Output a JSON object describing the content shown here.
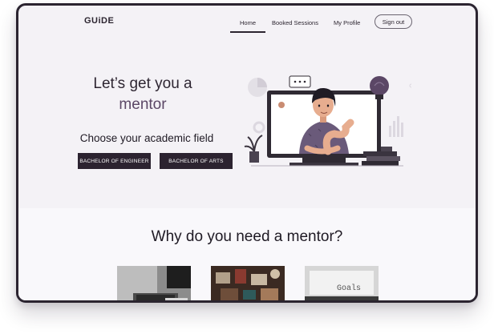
{
  "nav": {
    "logo": "GUiDE",
    "home": "Home",
    "booked": "Booked Sessions",
    "profile": "My Profile",
    "signout": "Sign out"
  },
  "hero": {
    "title_line1": "Let’s get you a",
    "title_line2": "mentor",
    "subtitle": "Choose your academic field",
    "btn_engineer": "BACHELOR OF ENGINEER",
    "btn_arts": "BACHELOR OF ARTS"
  },
  "why": {
    "title": "Why do you need a mentor?"
  },
  "cards": [
    {
      "icon": "laptop-photo"
    },
    {
      "icon": "desk-items-photo"
    },
    {
      "icon": "typewriter-goals-photo",
      "label": "Goals"
    }
  ],
  "colors": {
    "primary_dark": "#2c2330",
    "accent_purple": "#5b4766",
    "background": "#f4f2f6"
  }
}
